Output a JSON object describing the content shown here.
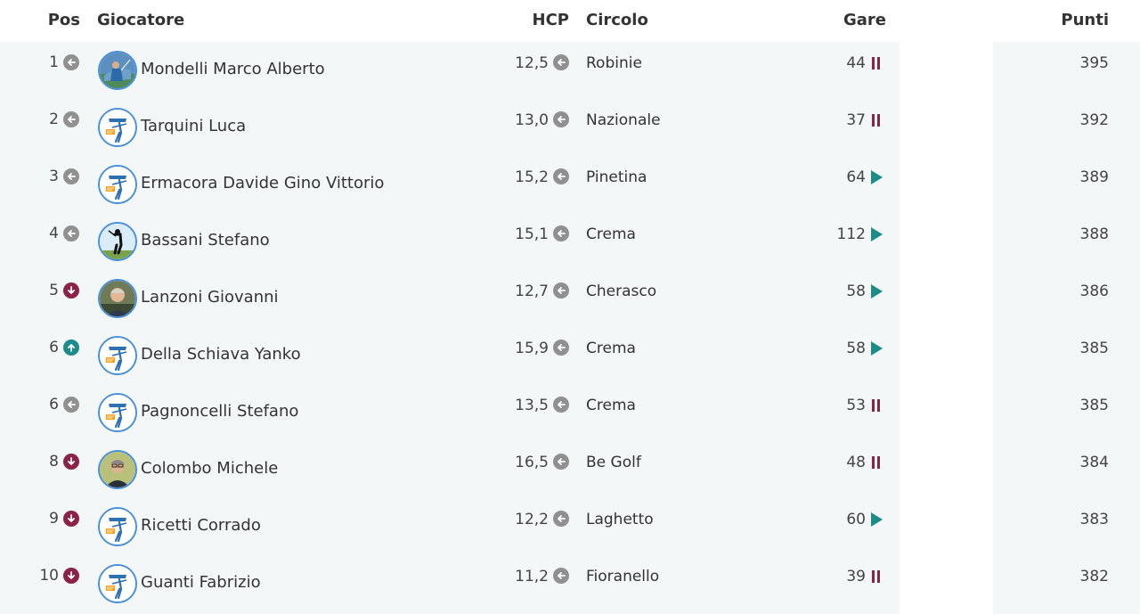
{
  "headers": {
    "pos": "Pos",
    "player": "Giocatore",
    "hcp": "HCP",
    "club": "Circolo",
    "games": "Gare",
    "points": "Punti"
  },
  "colors": {
    "down": "#8b2346",
    "up": "#1e8b8b",
    "same": "#909090",
    "pause": "#8b2346",
    "play": "#1e8b8b"
  },
  "rows": [
    {
      "pos": "1",
      "trend": "same",
      "avatar": "photo-golfer-blue",
      "name": "Mondelli Marco Alberto",
      "hcp": "12,5",
      "hcp_trend": "same",
      "club": "Robinie",
      "games": "44",
      "status": "pause",
      "points": "395"
    },
    {
      "pos": "2",
      "trend": "same",
      "avatar": "wegolf-logo",
      "name": "Tarquini Luca",
      "hcp": "13,0",
      "hcp_trend": "same",
      "club": "Nazionale",
      "games": "37",
      "status": "pause",
      "points": "392"
    },
    {
      "pos": "3",
      "trend": "same",
      "avatar": "wegolf-logo",
      "name": "Ermacora Davide Gino Vittorio",
      "hcp": "15,2",
      "hcp_trend": "same",
      "club": "Pinetina",
      "games": "64",
      "status": "play",
      "points": "389"
    },
    {
      "pos": "4",
      "trend": "same",
      "avatar": "photo-golfer-silhouette",
      "name": "Bassani Stefano",
      "hcp": "15,1",
      "hcp_trend": "same",
      "club": "Crema",
      "games": "112",
      "status": "play",
      "points": "388"
    },
    {
      "pos": "5",
      "trend": "down",
      "avatar": "photo-portrait",
      "name": "Lanzoni Giovanni",
      "hcp": "12,7",
      "hcp_trend": "same",
      "club": "Cherasco",
      "games": "58",
      "status": "play",
      "points": "386"
    },
    {
      "pos": "6",
      "trend": "up",
      "avatar": "wegolf-logo",
      "name": "Della Schiava Yanko",
      "hcp": "15,9",
      "hcp_trend": "same",
      "club": "Crema",
      "games": "58",
      "status": "play",
      "points": "385"
    },
    {
      "pos": "6",
      "trend": "same",
      "avatar": "wegolf-logo",
      "name": "Pagnoncelli Stefano",
      "hcp": "13,5",
      "hcp_trend": "same",
      "club": "Crema",
      "games": "53",
      "status": "pause",
      "points": "385"
    },
    {
      "pos": "8",
      "trend": "down",
      "avatar": "photo-portrait-glasses",
      "name": "Colombo Michele",
      "hcp": "16,5",
      "hcp_trend": "same",
      "club": "Be Golf",
      "games": "48",
      "status": "pause",
      "points": "384"
    },
    {
      "pos": "9",
      "trend": "down",
      "avatar": "wegolf-logo",
      "name": "Ricetti Corrado",
      "hcp": "12,2",
      "hcp_trend": "same",
      "club": "Laghetto",
      "games": "60",
      "status": "play",
      "points": "383"
    },
    {
      "pos": "10",
      "trend": "down",
      "avatar": "wegolf-logo",
      "name": "Guanti Fabrizio",
      "hcp": "11,2",
      "hcp_trend": "same",
      "club": "Fioranello",
      "games": "39",
      "status": "pause",
      "points": "382"
    }
  ]
}
